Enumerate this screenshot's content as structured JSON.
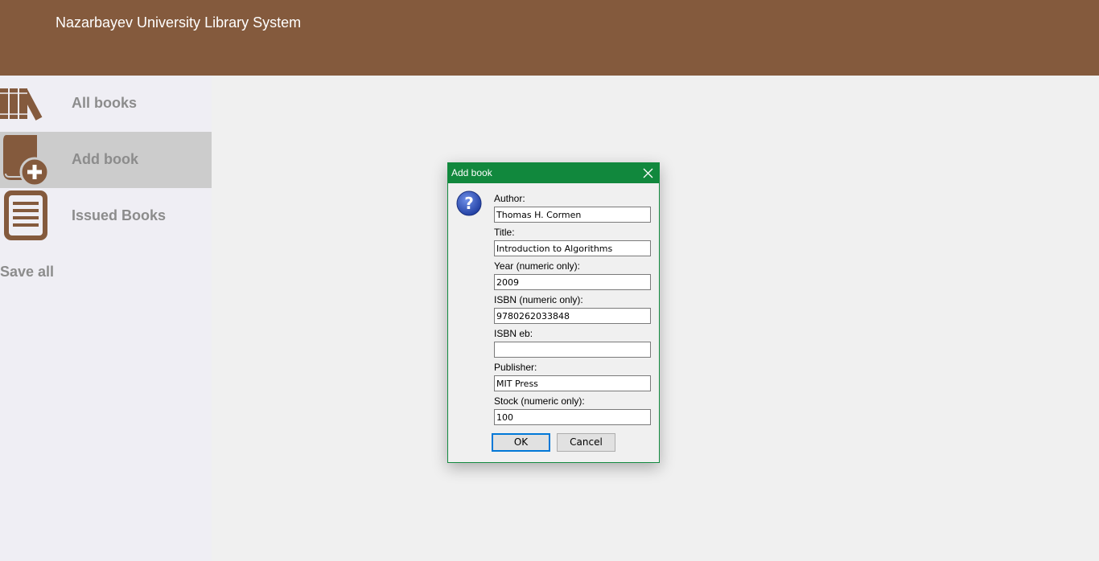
{
  "app": {
    "title": "Nazarbayev University Library System"
  },
  "sidebar": {
    "items": [
      {
        "label": "All books",
        "icon": "books-icon",
        "active": false
      },
      {
        "label": "Add book",
        "icon": "add-book-icon",
        "active": true
      },
      {
        "label": "Issued Books",
        "icon": "document-list-icon",
        "active": false
      }
    ],
    "save_all": "Save all"
  },
  "dialog": {
    "title": "Add book",
    "icon": "question-icon",
    "fields": [
      {
        "label": "Author:",
        "value": "Thomas H. Cormen"
      },
      {
        "label": "Title:",
        "value": "Introduction to Algorithms"
      },
      {
        "label": "Year (numeric only):",
        "value": "2009"
      },
      {
        "label": "ISBN (numeric only):",
        "value": "9780262033848"
      },
      {
        "label": "ISBN eb:",
        "value": ""
      },
      {
        "label": "Publisher:",
        "value": "MIT Press"
      },
      {
        "label": "Stock (numeric only):",
        "value": "100"
      }
    ],
    "ok_label": "OK",
    "cancel_label": "Cancel"
  },
  "colors": {
    "header": "#845a3d",
    "icon_brown": "#845a3d",
    "dialog_titlebar": "#11883d",
    "sidebar_bg": "#efeef4",
    "active_item_bg": "#cccccc",
    "nav_text": "#8c8c8c"
  }
}
